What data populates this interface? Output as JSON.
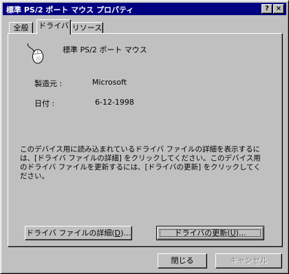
{
  "window": {
    "title": "標準 PS/2 ポート マウス プロパティ",
    "help_button": "?",
    "close_button": "×"
  },
  "tabs": [
    {
      "label": "全般",
      "active": false
    },
    {
      "label": "ドライバ",
      "active": true
    },
    {
      "label": "リソース",
      "active": false
    }
  ],
  "device": {
    "icon": "mouse-icon",
    "name": "標準 PS/2 ポート マウス"
  },
  "details": {
    "manufacturer_label": "製造元 :",
    "manufacturer_value": "Microsoft",
    "date_label": "日付 :",
    "date_value": "6-12-1998"
  },
  "description": "このデバイス用に読み込まれているドライバ ファイルの詳細を表示するには、[ドライバ ファイルの詳細] をクリックしてください。このデバイス用のドライバ ファイルを更新するには、[ドライバの更新] をクリックしてください。",
  "buttons": {
    "driver_details_text": "ドライバ ファイルの詳細(",
    "driver_details_key": "D",
    "driver_details_tail": ")...",
    "update_driver_text": "ドライバの更新(",
    "update_driver_key": "U",
    "update_driver_tail": ")...",
    "close_label": "閉じる",
    "cancel_label": "キャンセル"
  }
}
